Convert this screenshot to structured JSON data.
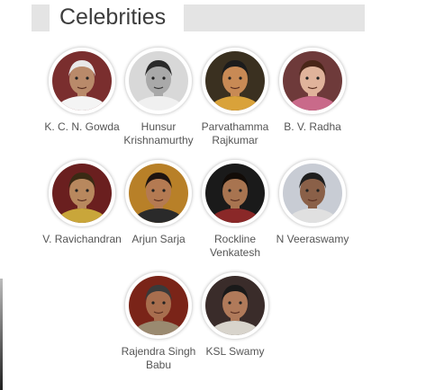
{
  "section": {
    "title": "Celebrities"
  },
  "celebrities": [
    {
      "name": "K. C. N. Gowda",
      "bg": "#7a2e2e",
      "skin": "#b98a6a",
      "hair": "#e8e8e8",
      "shirt": "#f4f4f4",
      "bw": false
    },
    {
      "name": "Hunsur Krishnamurthy",
      "bg": "#d8d8d8",
      "skin": "#a9a9a9",
      "hair": "#2a2a2a",
      "shirt": "#f0f0f0",
      "bw": true
    },
    {
      "name": "Parvathamma Rajkumar",
      "bg": "#3a3020",
      "skin": "#c88a55",
      "hair": "#1c1c1c",
      "shirt": "#d9a23a",
      "bw": false
    },
    {
      "name": "B. V. Radha",
      "bg": "#6e3a3a",
      "skin": "#e0b39b",
      "hair": "#4a2618",
      "shirt": "#c96a8a",
      "bw": false
    },
    {
      "name": "V. Ravichandran",
      "bg": "#6a1f1f",
      "skin": "#b8885e",
      "hair": "#3a2a14",
      "shirt": "#c9a63a",
      "bw": false
    },
    {
      "name": "Arjun Sarja",
      "bg": "#b88028",
      "skin": "#b47a52",
      "hair": "#1e1410",
      "shirt": "#2a2a2a",
      "bw": false
    },
    {
      "name": "Rockline Venkatesh",
      "bg": "#1a1a1a",
      "skin": "#a87450",
      "hair": "#120c08",
      "shirt": "#8a2828",
      "bw": false
    },
    {
      "name": "N Veeraswamy",
      "bg": "#c8ccd4",
      "skin": "#8a6048",
      "hair": "#1e1e1e",
      "shirt": "#e0e0e0",
      "bw": false
    },
    {
      "name": "Rajendra Singh Babu",
      "bg": "#7a2418",
      "skin": "#a86e4e",
      "hair": "#3a3a3a",
      "shirt": "#9a8a70",
      "bw": false
    },
    {
      "name": "KSL Swamy",
      "bg": "#3a2c2a",
      "skin": "#b07a5a",
      "hair": "#1a1a1a",
      "shirt": "#d8d4cc",
      "bw": false
    }
  ]
}
